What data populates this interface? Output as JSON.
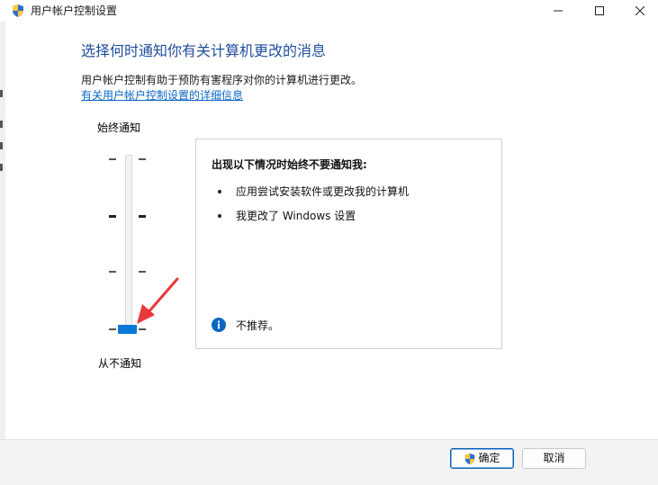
{
  "window": {
    "title": "用户帐户控制设置",
    "controls": {
      "minimize": "minimize",
      "maximize": "maximize",
      "close": "close"
    }
  },
  "content": {
    "headline": "选择何时通知你有关计算机更改的消息",
    "description": "用户帐户控制有助于预防有害程序对你的计算机进行更改。",
    "link": "有关用户帐户控制设置的详细信息"
  },
  "slider": {
    "top_label": "始终通知",
    "bottom_label": "从不通知",
    "levels": 4,
    "selected_level": 1
  },
  "info_panel": {
    "heading": "出现以下情况时始终不要通知我:",
    "bullets": [
      "应用尝试安装软件或更改我的计算机",
      "我更改了 Windows 设置"
    ],
    "note": "不推荐。"
  },
  "buttons": {
    "ok": "确定",
    "cancel": "取消"
  },
  "colors": {
    "headline": "#1f4e9c",
    "link": "#0b66c7",
    "thumb": "#0a78d7",
    "arrow": "#e8393b"
  }
}
